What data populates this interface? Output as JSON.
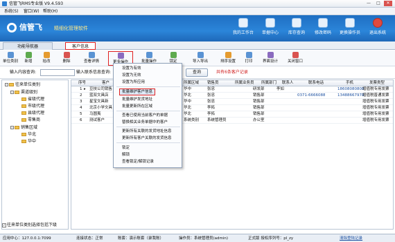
{
  "window": {
    "title": "信管飞RMS专业版 V9.4.593",
    "min": "—",
    "max": "□",
    "close": "✕"
  },
  "menubar": [
    "系统(S)",
    "窗口(W)",
    "帮助(H)"
  ],
  "banner": {
    "logo_text": "信管飞",
    "slogan": "精细化管理软件"
  },
  "top_buttons": [
    "我的工作台",
    "单据中心",
    "库存查询",
    "修改密码",
    "更换操作员",
    "退出系统"
  ],
  "tabs": {
    "nav": "功能导航器",
    "customer": "客户信息"
  },
  "toolbar": [
    "单位类别",
    "新增",
    "拾改",
    "删除",
    "查看详情",
    "更多操作",
    "批量操作",
    "锁定",
    "导入导出",
    "排序设置",
    "打印",
    "界面设计",
    "关闭窗口"
  ],
  "filter": {
    "input_label": "输入内容查询:",
    "category_label": "输入联系信息查询:",
    "query_button": "查询",
    "record_count": "共有6条客户记录"
  },
  "tree": {
    "root": "往来单位类别",
    "nodes": [
      {
        "label": "渠道级别",
        "level": 1,
        "box": "-"
      },
      {
        "label": "省级代理",
        "level": 2
      },
      {
        "label": "市级代理",
        "level": 2
      },
      {
        "label": "县级代理",
        "level": 2
      },
      {
        "label": "零售商",
        "level": 2
      },
      {
        "label": "销售区域",
        "level": 1,
        "box": "-"
      },
      {
        "label": "华北",
        "level": 2
      },
      {
        "label": "华中",
        "level": 2
      }
    ],
    "footer_checkbox": "往来单位类别选择包括下级"
  },
  "grid": {
    "columns": [
      "序号",
      "客户",
      "所属区域",
      "销售员",
      "所属业务员",
      "所属部门",
      "联系人",
      "联系电话",
      "手机",
      "发票类型"
    ],
    "rows": [
      {
        "no": "1",
        "name": "豆技公司销售",
        "region": "华中",
        "sales": "张忠",
        "dept": "研发部",
        "contact": "李如",
        "phone": "",
        "mobile": "18608080808",
        "invoice": "增值税专用发票"
      },
      {
        "no": "2",
        "name": "蓝双文具店",
        "region": "华北",
        "sales": "张忠",
        "dept": "销售部",
        "contact": "",
        "phone": "0371-6666088",
        "mobile": "13488667978",
        "invoice": "增值税普通发票"
      },
      {
        "no": "3",
        "name": "星宝文具新",
        "region": "华中",
        "sales": "张忠",
        "dept": "销售部",
        "contact": "",
        "phone": "",
        "mobile": "",
        "invoice": "增值税专用发票"
      },
      {
        "no": "4",
        "name": "北京小学文具",
        "region": "华北",
        "sales": "李拓",
        "dept": "销售部",
        "contact": "",
        "phone": "",
        "mobile": "",
        "invoice": "增值税专用发票"
      },
      {
        "no": "5",
        "name": "马圆夷",
        "region": "华北",
        "sales": "李拓",
        "dept": "销售部",
        "contact": "",
        "phone": "",
        "mobile": "",
        "invoice": "增值税专用发票"
      },
      {
        "no": "6",
        "name": "测试客户",
        "region": "系统类别",
        "sales": "系统管理员",
        "dept": "办公室",
        "contact": "",
        "phone": "",
        "mobile": "",
        "invoice": "增值税专用发票"
      }
    ]
  },
  "context_menu": {
    "items": [
      "设置为有效",
      "设置为无效",
      "设置为所应用",
      "批量维护客户信息",
      "批量维护发货地址",
      "批量更新所在区域",
      "查看已使用当前客户的单据",
      "替换相关业务单据中的客户",
      "更新所有关联的发货地址信息",
      "更新所有客户关联的发货信息",
      "锁定",
      "解锁",
      "查看锁定/解锁记录"
    ],
    "highlighted": "批量维护客户信息"
  },
  "status": {
    "server": "应用中心：127.0.0.1:7099",
    "link": "连接状态：正常",
    "account": "账套：演示账套（录我账）",
    "operator": "操作员：系统管理员(admin)",
    "license": "正式版  授权序列号：pl_zy",
    "exit": "清除登陆记录"
  }
}
